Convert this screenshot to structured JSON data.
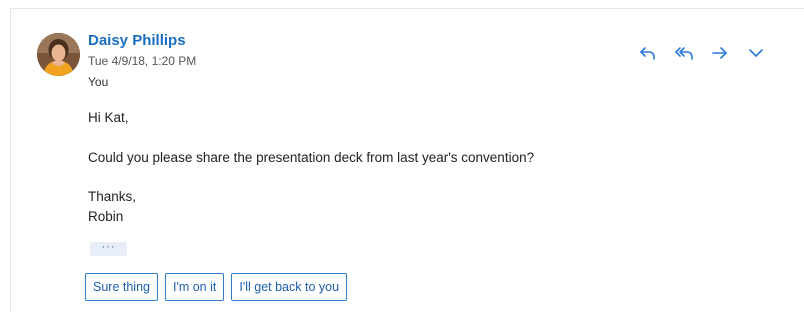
{
  "sender": {
    "name": "Daisy Phillips",
    "date": "Tue 4/9/18, 1:20 PM",
    "recipient": "You"
  },
  "actions": {
    "icons": [
      "reply-icon",
      "reply-all-icon",
      "forward-icon",
      "chevron-down-icon"
    ],
    "color": "#2a7ad6"
  },
  "body": {
    "greeting": "Hi Kat,",
    "line1": "Could you please share the presentation deck from last year's convention?",
    "signoff": "Thanks,",
    "signature": "Robin"
  },
  "more": {
    "label": "···"
  },
  "suggested_replies": [
    "Sure thing",
    "I'm on it",
    "I'll get back to you"
  ],
  "colors": {
    "accent": "#1a6fc2",
    "border": "#2f7bcc"
  }
}
